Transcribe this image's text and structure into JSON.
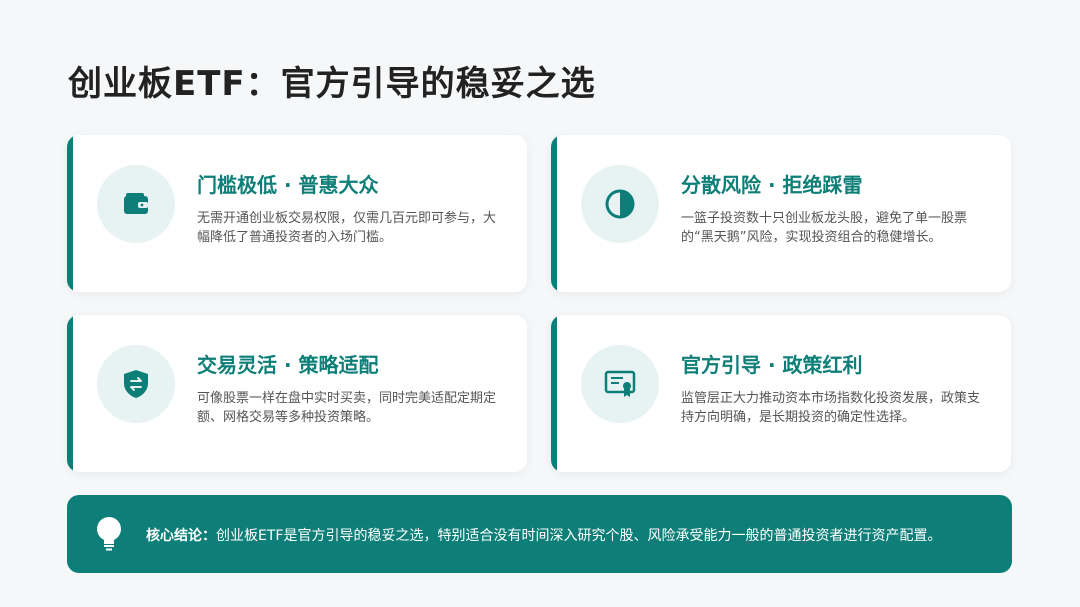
{
  "title": "创业板ETF：官方引导的稳妥之选",
  "cards": [
    {
      "heading": "门槛极低 · 普惠大众",
      "description": "无需开通创业板交易权限，仅需几百元即可参与，大幅降低了普通投资者的入场门槛。",
      "icon": "wallet-icon"
    },
    {
      "heading": "分散风险 · 拒绝踩雷",
      "description": "一篮子投资数十只创业板龙头股，避免了单一股票的“黑天鹅”风险，实现投资组合的稳健增长。",
      "icon": "half-circle-icon"
    },
    {
      "heading": "交易灵活 · 策略适配",
      "description": "可像股票一样在盘中实时买卖，同时完美适配定期定额、网格交易等多种投资策略。",
      "icon": "shield-exchange-icon"
    },
    {
      "heading": "官方引导 · 政策红利",
      "description": "监管层正大力推动资本市场指数化投资发展，政策支持方向明确，是长期投资的确定性选择。",
      "icon": "certificate-icon"
    }
  ],
  "conclusion": {
    "label": "核心结论：",
    "text": "创业板ETF是官方引导的稳妥之选，特别适合没有时间深入研究个股、风险承受能力一般的普通投资者进行资产配置。",
    "icon": "lightbulb-icon"
  },
  "colors": {
    "accent": "#0e7f78",
    "icon_bg": "#e6f3f2",
    "background": "#f5f7f9"
  }
}
